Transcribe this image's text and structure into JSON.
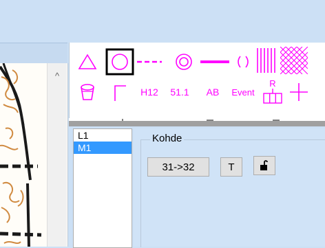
{
  "symbols": {
    "row1": [
      {
        "icon": "triangle-icon"
      },
      {
        "icon": "circle-icon",
        "selected": true
      },
      {
        "icon": "dash-line-icon"
      },
      {
        "icon": "double-circle-icon"
      },
      {
        "icon": "thick-line-icon"
      },
      {
        "icon": "bracket-icon"
      },
      {
        "icon": "vertical-hatch-icon"
      },
      {
        "icon": "cross-hatch-icon"
      }
    ],
    "row2": [
      {
        "icon": "cup-icon"
      },
      {
        "icon": "corner-icon"
      },
      {
        "text": "H12"
      },
      {
        "text": "51.1"
      },
      {
        "text": "AB"
      },
      {
        "text": "Event"
      },
      {
        "icon": "r-table-icon",
        "text": "R"
      },
      {
        "icon": "plus-icon"
      }
    ],
    "color": "#ff00ff"
  },
  "courses": {
    "items": [
      "L1",
      "M1"
    ],
    "selected_index": 1
  },
  "object_panel": {
    "title": "Kohde",
    "control_button": "31->32",
    "text_button": "T",
    "lock_icon": "unlock-icon"
  },
  "scroll_up": "^"
}
